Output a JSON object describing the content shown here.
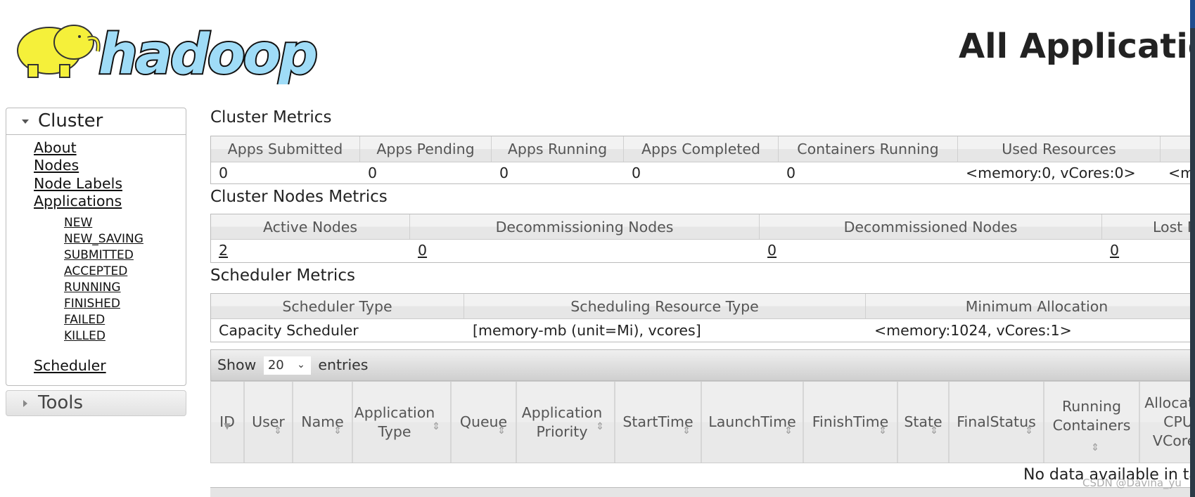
{
  "logo": {
    "text": "hadoop",
    "colors": {
      "elephant": "#f5f03a",
      "wordmark": "#9fdcf7"
    }
  },
  "header": {
    "title": "All Applications"
  },
  "sidebar": {
    "cluster": {
      "label": "Cluster",
      "expanded": true,
      "links": [
        "About",
        "Nodes",
        "Node Labels",
        "Applications"
      ],
      "app_states": [
        "NEW",
        "NEW_SAVING",
        "SUBMITTED",
        "ACCEPTED",
        "RUNNING",
        "FINISHED",
        "FAILED",
        "KILLED"
      ],
      "scheduler": "Scheduler"
    },
    "tools": {
      "label": "Tools",
      "expanded": false
    }
  },
  "cluster_metrics": {
    "title": "Cluster Metrics",
    "headers": [
      "Apps Submitted",
      "Apps Pending",
      "Apps Running",
      "Apps Completed",
      "Containers Running",
      "Used Resources",
      ""
    ],
    "values": [
      "0",
      "0",
      "0",
      "0",
      "0",
      "<memory:0, vCores:0>",
      "<m"
    ]
  },
  "nodes_metrics": {
    "title": "Cluster Nodes Metrics",
    "headers": [
      "Active Nodes",
      "Decommissioning Nodes",
      "Decommissioned Nodes",
      "Lost N"
    ],
    "values": [
      "2",
      "0",
      "0",
      "0"
    ]
  },
  "scheduler_metrics": {
    "title": "Scheduler Metrics",
    "headers": [
      "Scheduler Type",
      "Scheduling Resource Type",
      "Minimum Allocation"
    ],
    "values": [
      "Capacity Scheduler",
      "[memory-mb (unit=Mi), vcores]",
      "<memory:1024, vCores:1>"
    ]
  },
  "apps_table": {
    "show_label": "Show",
    "entries_value": "20",
    "entries_label": "entries",
    "columns": [
      "ID",
      "User",
      "Name",
      "Application Type",
      "Queue",
      "Application Priority",
      "StartTime",
      "LaunchTime",
      "FinishTime",
      "State",
      "FinalStatus",
      "Running Containers",
      "Allocated CPU VCores"
    ],
    "empty_message": "No data available in table"
  },
  "watermark": "CSDN @Davina_yu"
}
